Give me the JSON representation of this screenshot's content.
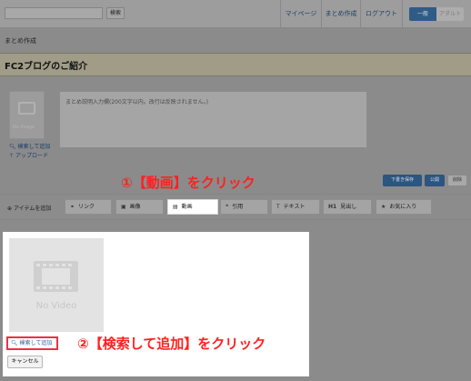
{
  "header": {
    "search_button": "検索",
    "nav": [
      "マイページ",
      "まとめ作成",
      "ログアウト"
    ],
    "segment": [
      "一般",
      "アダルト"
    ]
  },
  "page_heading": "まとめ作成",
  "matome_title": "FC2ブログのご紹介",
  "thumbnail": {
    "placeholder_label": "No image",
    "search_add_label": "検索して追加",
    "upload_label": "アップロード"
  },
  "description": {
    "placeholder": "まとめ説明入力欄(200文字以内。改行は反映されません。)"
  },
  "actions": {
    "draft_label": "下書き保存",
    "publish_label": "公開",
    "delete_label": "削除"
  },
  "annotations": {
    "step1": "①【動画】をクリック",
    "step2": "②【検索して追加】をクリック",
    "color": "#ff2020"
  },
  "item_toolbar": {
    "add_item_label": "アイテムを追加",
    "buttons": [
      {
        "label": "リンク",
        "icon": "link-icon"
      },
      {
        "label": "画像",
        "icon": "image-icon"
      },
      {
        "label": "動画",
        "icon": "film-icon",
        "selected": true
      },
      {
        "label": "引用",
        "icon": "quote-icon"
      },
      {
        "label": "テキスト",
        "icon": "text-icon"
      },
      {
        "label": "見出し",
        "icon": "heading-icon"
      },
      {
        "label": "お気に入り",
        "icon": "star-icon"
      }
    ]
  },
  "video_panel": {
    "placeholder_label": "No Video",
    "search_add_label": "検索して追加",
    "cancel_label": "キャンセル",
    "highlight_color": "#e8334a"
  }
}
